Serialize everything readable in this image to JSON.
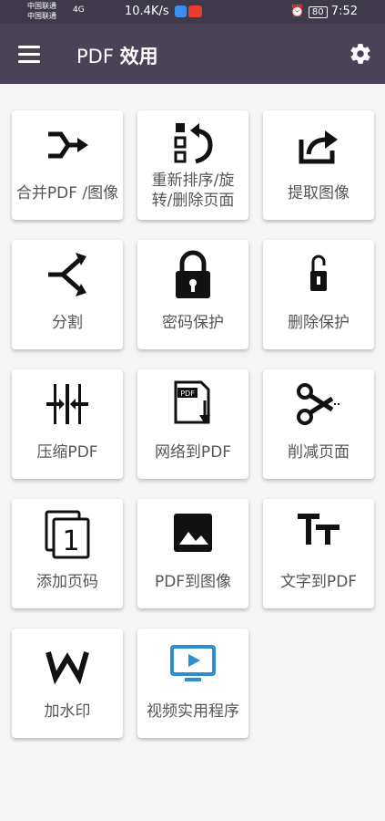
{
  "status_bar": {
    "carrier1": "中国联通",
    "carrier2": "中国联通",
    "signal": "4G",
    "speed": "10.4K/s",
    "battery": "80",
    "time": "7:52"
  },
  "toolbar": {
    "title_prefix": "PDF",
    "title_main": "效用",
    "menu_icon": "hamburger-menu-icon",
    "settings_icon": "gear-icon"
  },
  "tiles": [
    {
      "label": "合并PDF /图像",
      "icon": "merge-icon"
    },
    {
      "label": "重新排序/旋转/删除页面",
      "icon": "reorder-rotate-icon"
    },
    {
      "label": "提取图像",
      "icon": "extract-share-icon"
    },
    {
      "label": "分割",
      "icon": "split-icon"
    },
    {
      "label": "密码保护",
      "icon": "lock-icon"
    },
    {
      "label": "删除保护",
      "icon": "unlock-icon"
    },
    {
      "label": "压缩PDF",
      "icon": "compress-icon"
    },
    {
      "label": "网络到PDF",
      "icon": "web-to-pdf-icon"
    },
    {
      "label": "削减页面",
      "icon": "scissors-icon"
    },
    {
      "label": "添加页码",
      "icon": "page-number-icon"
    },
    {
      "label": "PDF到图像",
      "icon": "image-icon"
    },
    {
      "label": "文字到PDF",
      "icon": "text-icon"
    },
    {
      "label": "加水印",
      "icon": "watermark-icon"
    },
    {
      "label": "视频实用程序",
      "icon": "video-icon"
    }
  ],
  "colors": {
    "toolbar": "#4a4357",
    "status_bar": "#3f3a4a",
    "video_icon": "#2e8fd0"
  }
}
